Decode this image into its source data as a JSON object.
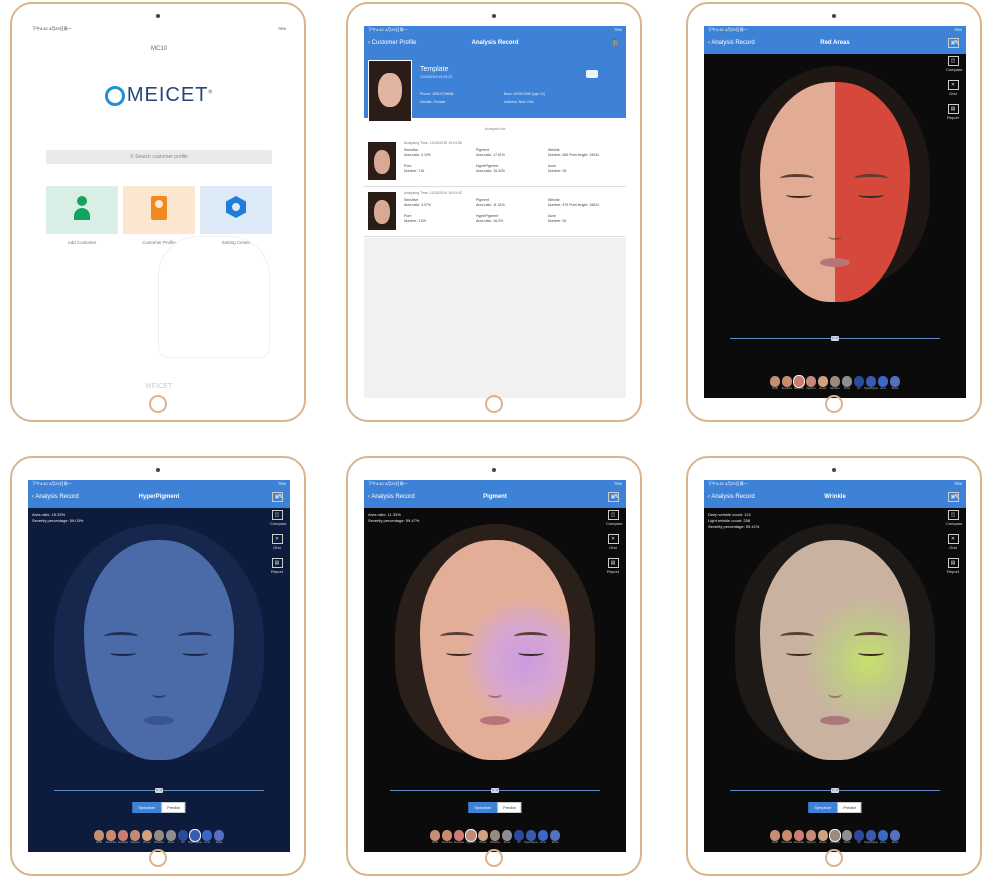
{
  "status": {
    "time": "下午4:42 4月29日周一",
    "battery": "75%"
  },
  "home": {
    "device": "MC10",
    "brand": "MEICET",
    "brand_mark": "®",
    "search_placeholder": "Search customer profile",
    "cards": [
      {
        "label": "Add Customer",
        "icon": "add-user-icon",
        "color": "#d9efe6"
      },
      {
        "label": "Customer Profile",
        "icon": "profile-file-icon",
        "color": "#fbe6cf"
      },
      {
        "label": "Setting Center",
        "icon": "settings-hex-icon",
        "color": "#dce9f7"
      }
    ],
    "footer": "MEICET"
  },
  "record": {
    "back": "Customer Profile",
    "title": "Analysis Record",
    "profile": {
      "name": "Template",
      "date": "12/18/2019 19:03:23",
      "phone_label": "Phone:",
      "phone": "18012739636",
      "gender_label": "Gender:",
      "gender": "Female",
      "born_label": "Born:",
      "born": "03/25/1995 (age 24)",
      "address_label": "Address:",
      "address": "New York"
    },
    "list_title": "Analysis list",
    "records": [
      {
        "time_label": "Analyzing Time:",
        "time": "12/18/2019 19:04:56",
        "cells": [
          {
            "name": "Sensitive",
            "line": "Area ratio: 3.19%"
          },
          {
            "name": "Pigment",
            "line": "Area ratio: 17.61%"
          },
          {
            "name": "Wrinkle",
            "line": "Number: 480  Pixel length: 19034"
          },
          {
            "name": "Pore",
            "line": "Number: 716"
          },
          {
            "name": "HyperPigment",
            "line": "Area ratio: 15.34%"
          },
          {
            "name": "Acne",
            "line": "Number: 28"
          }
        ]
      },
      {
        "time_label": "Analyzing Time:",
        "time": "12/18/2019 19:03:42",
        "cells": [
          {
            "name": "Sensitive",
            "line": "Area ratio: 3.07%"
          },
          {
            "name": "Pigment",
            "line": "Area ratio: 11.31%"
          },
          {
            "name": "Wrinkle",
            "line": "Number: 379  Pixel length: 15624"
          },
          {
            "name": "Pore",
            "line": "Number: 1109"
          },
          {
            "name": "HyperPigment",
            "line": "Area ratio: 16.2%"
          },
          {
            "name": "Acne",
            "line": "Number: 26"
          }
        ]
      }
    ]
  },
  "red_areas": {
    "back": "Analysis Record",
    "title": "Red Areas"
  },
  "hyper": {
    "back": "Analysis Record",
    "title": "HyperPigment",
    "info": [
      "Area ratio: 15.33%",
      "Severity percentage: 59.03%"
    ]
  },
  "pigment": {
    "back": "Analysis Record",
    "title": "Pigment",
    "info": [
      "Area ratio: 11.33%",
      "Severity percentage: 59.47%"
    ]
  },
  "wrinkle": {
    "back": "Analysis Record",
    "title": "Wrinkle",
    "info": [
      "Deep wrinkle count: 121",
      "Light wrinkle count: 258",
      "Severity percentage: 59.41%"
    ]
  },
  "tools": [
    {
      "label": "",
      "icon": "layout-icon"
    },
    {
      "label": "Compare",
      "icon": "compare-icon"
    },
    {
      "label": "Grid",
      "icon": "grid-icon"
    },
    {
      "label": "Report",
      "icon": "report-icon"
    }
  ],
  "segment": {
    "left": "Symptom",
    "right": "Predict"
  },
  "slider_label": "1 : 2",
  "thumbnails": [
    {
      "label": "RGB",
      "color": "#c58d74"
    },
    {
      "label": "Sunshine",
      "color": "#c98b70"
    },
    {
      "label": "Sensitive",
      "color": "#d07b72"
    },
    {
      "label": "Pigment",
      "color": "#c48a78"
    },
    {
      "label": "Brown",
      "color": "#d3a07e"
    },
    {
      "label": "Wrinkles",
      "color": "#9a8a80"
    },
    {
      "label": "Pores",
      "color": "#8e8e90"
    },
    {
      "label": "UV",
      "color": "#2c4a9a"
    },
    {
      "label": "HyperPigment",
      "color": "#385bb0"
    },
    {
      "label": "Acne",
      "color": "#3a67c8"
    },
    {
      "label": "Wood",
      "color": "#5570c0"
    }
  ]
}
